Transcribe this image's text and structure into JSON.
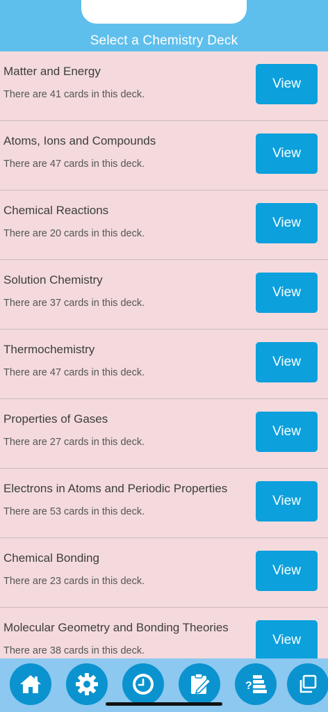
{
  "header": {
    "title": "Select a Chemistry Deck"
  },
  "decks": [
    {
      "title": "Matter and Energy",
      "subtitle": "There are 41 cards in this deck.",
      "button": "View"
    },
    {
      "title": "Atoms, Ions and Compounds",
      "subtitle": "There are 47 cards in this deck.",
      "button": "View"
    },
    {
      "title": "Chemical Reactions",
      "subtitle": "There are 20 cards in this deck.",
      "button": "View"
    },
    {
      "title": "Solution Chemistry",
      "subtitle": "There are 37 cards in this deck.",
      "button": "View"
    },
    {
      "title": "Thermochemistry",
      "subtitle": "There are 47 cards in this deck.",
      "button": "View"
    },
    {
      "title": "Properties of Gases",
      "subtitle": "There are 27 cards in this deck.",
      "button": "View"
    },
    {
      "title": "Electrons in Atoms and Periodic Properties",
      "subtitle": "There are 53 cards in this deck.",
      "button": "View"
    },
    {
      "title": "Chemical Bonding",
      "subtitle": "There are 23 cards in this deck.",
      "button": "View"
    },
    {
      "title": "Molecular Geometry and Bonding Theories",
      "subtitle": "There are 38 cards in this deck.",
      "button": "View"
    }
  ],
  "tabbar": {
    "tabs": [
      {
        "icon": "home-icon"
      },
      {
        "icon": "gear-icon"
      },
      {
        "icon": "clock-icon"
      },
      {
        "icon": "notepad-pencil-icon"
      },
      {
        "icon": "quiz-list-icon"
      },
      {
        "icon": "copy-icon"
      }
    ]
  },
  "colors": {
    "header": "#5fbfec",
    "background": "#f4dadd",
    "button": "#0ca0dd",
    "tabbar": "#8cc8f0",
    "tab_circle": "#0a93cf"
  }
}
